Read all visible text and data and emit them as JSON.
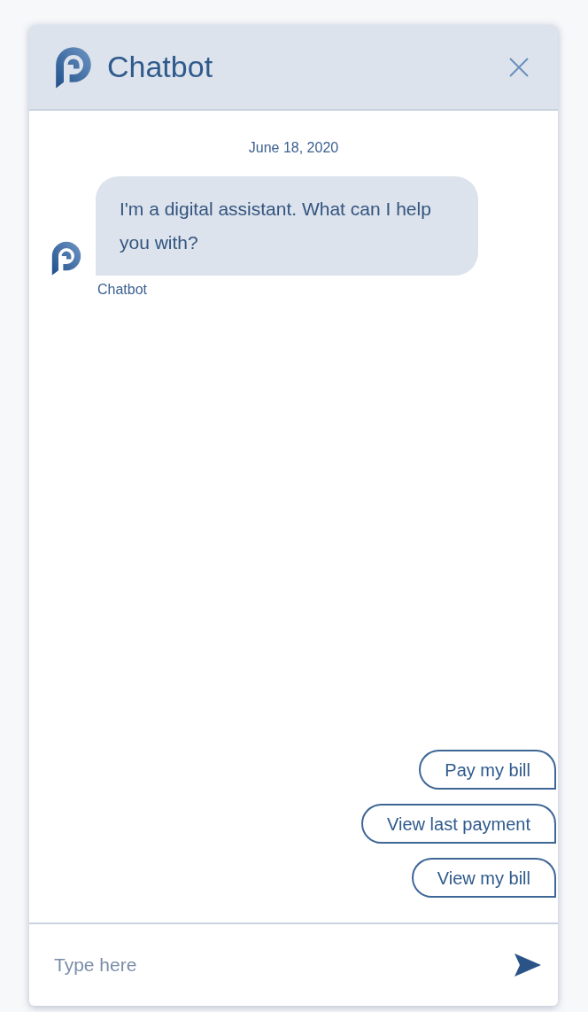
{
  "header": {
    "title": "Chatbot"
  },
  "date": "June 18, 2020",
  "messages": [
    {
      "text": "I'm a digital assistant. What can I help you with?",
      "sender": "Chatbot"
    }
  ],
  "quick_replies": [
    "Pay my bill",
    "View last payment",
    "View my bill"
  ],
  "input": {
    "placeholder": "Type here"
  }
}
